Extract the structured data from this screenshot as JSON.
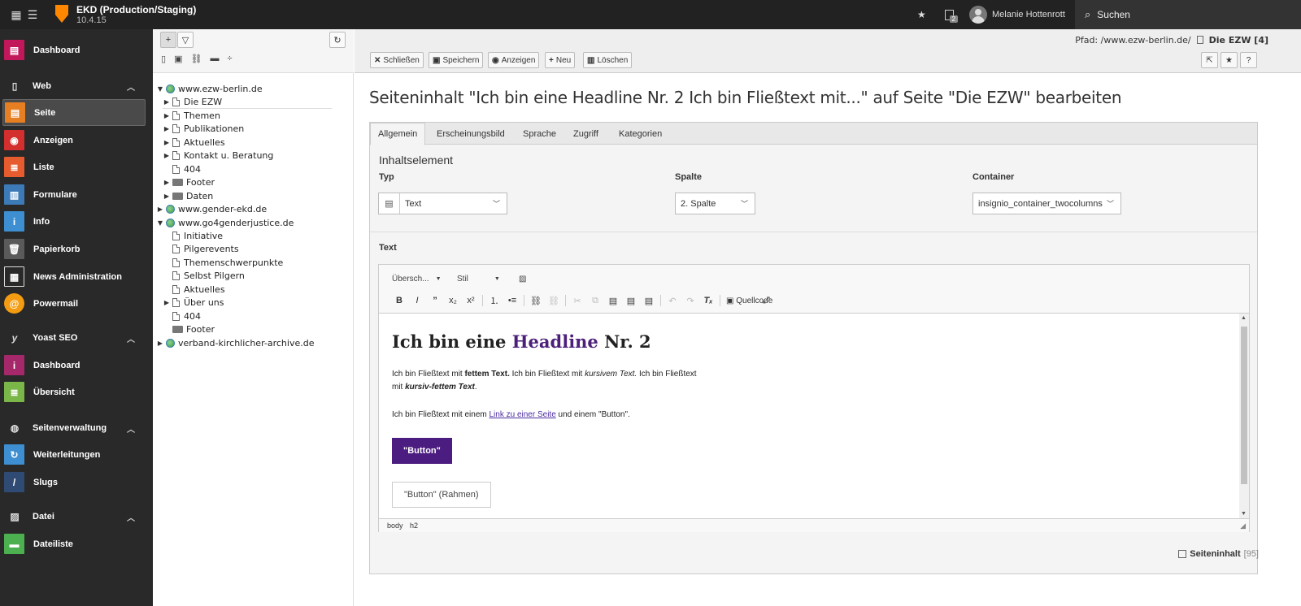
{
  "topbar": {
    "site_name": "EKD (Production/Staging)",
    "version": "10.4.15",
    "notification_count": "2",
    "user_name": "Melanie Hottenrott",
    "search_label": "Suchen"
  },
  "sidebar": {
    "groups": {
      "web": "Web",
      "yoast": "Yoast SEO",
      "seitenverwaltung": "Seitenverwaltung",
      "datei": "Datei"
    },
    "items": {
      "dashboard": "Dashboard",
      "seite": "Seite",
      "anzeigen": "Anzeigen",
      "liste": "Liste",
      "formulare": "Formulare",
      "info": "Info",
      "papierkorb": "Papierkorb",
      "news": "News Administration",
      "powermail": "Powermail",
      "yoast_dashboard": "Dashboard",
      "uebersicht": "Übersicht",
      "weiterleitungen": "Weiterleitungen",
      "slugs": "Slugs",
      "dateiliste": "Dateiliste"
    },
    "colors": {
      "dashboard": "#c2185b",
      "seite": "#e67e22",
      "anzeigen": "#d32f2f",
      "liste": "#e65c2e",
      "formulare": "#3d7ab8",
      "info": "#3d8fd1",
      "papierkorb": "#5a5a5a",
      "powermail": "#f39c12",
      "yoast": "#a4286a",
      "uebersicht": "#7ab648",
      "weiterleitungen": "#3d8fd1",
      "slugs": "#2f4a73",
      "dateiliste": "#4caf50"
    }
  },
  "tree": {
    "nodes": [
      {
        "label": "www.ezw-berlin.de"
      },
      {
        "label": "Die EZW"
      },
      {
        "label": "Themen"
      },
      {
        "label": "Publikationen"
      },
      {
        "label": "Aktuelles"
      },
      {
        "label": "Kontakt u. Beratung"
      },
      {
        "label": "404"
      },
      {
        "label": "Footer"
      },
      {
        "label": "Daten"
      },
      {
        "label": "www.gender-ekd.de"
      },
      {
        "label": "www.go4genderjustice.de"
      },
      {
        "label": "Initiative"
      },
      {
        "label": "Pilgerevents"
      },
      {
        "label": "Themenschwerpunkte"
      },
      {
        "label": "Selbst Pilgern"
      },
      {
        "label": "Aktuelles"
      },
      {
        "label": "Über uns"
      },
      {
        "label": "404"
      },
      {
        "label": "Footer"
      },
      {
        "label": "verband-kirchlicher-archive.de"
      }
    ]
  },
  "docheader": {
    "path_label": "Pfad: /www.ezw-berlin.de/",
    "path_page": "Die EZW [4]",
    "buttons": {
      "close": "Schließen",
      "save": "Speichern",
      "view": "Anzeigen",
      "new": "Neu",
      "delete": "Löschen"
    }
  },
  "main": {
    "title": "Seiteninhalt \"Ich bin eine Headline Nr. 2 Ich bin Fließtext mit...\" auf Seite \"Die EZW\" bearbeiten",
    "tabs": [
      "Allgemein",
      "Erscheinungsbild",
      "Sprache",
      "Zugriff",
      "Kategorien"
    ],
    "section_title": "Inhaltselement",
    "fields": {
      "typ_label": "Typ",
      "typ_value": "Text",
      "spalte_label": "Spalte",
      "spalte_value": "2. Spalte",
      "container_label": "Container",
      "container_value": "insignio_container_twocolumns"
    },
    "text_label": "Text",
    "editor": {
      "format_combo": "Übersch...",
      "style_combo": "Stil",
      "source_label": "Quellcode",
      "heading_a": "Ich bin eine ",
      "heading_b": "Headline",
      "heading_c": " Nr. 2",
      "p1_a": "Ich bin Fließtext mit ",
      "p1_b": "fettem Text.",
      "p1_c": " Ich bin Fließtext mit ",
      "p1_d": "kursivem Text.",
      "p1_e": " Ich bin Fließtext",
      "p1_f": "mit ",
      "p1_g": "kursiv-fettem Text",
      "p1_h": ".",
      "p2_a": "Ich bin Fließtext mit einem ",
      "p2_link": "Link zu einer Seite",
      "p2_b": " und einem \"Button\".",
      "button1": "\"Button\"",
      "button2": "\"Button\" (Rahmen)",
      "element_path": "body h2"
    },
    "footer_label": "Seiteninhalt",
    "footer_id": "[95]"
  }
}
